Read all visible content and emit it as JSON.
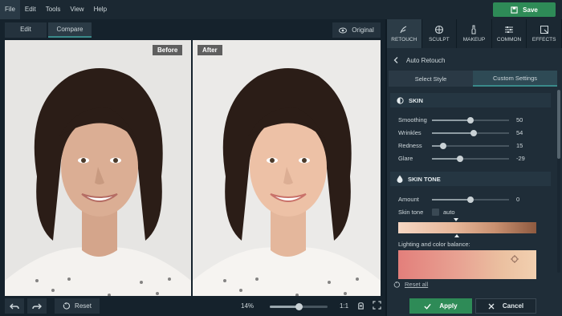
{
  "menu": {
    "items": [
      "File",
      "Edit",
      "Tools",
      "View",
      "Help"
    ],
    "save_label": "Save"
  },
  "view": {
    "edit_label": "Edit",
    "compare_label": "Compare",
    "original_label": "Original",
    "before_label": "Before",
    "after_label": "After"
  },
  "bottom": {
    "reset_label": "Reset",
    "zoom_percent": "14%",
    "zoom_level": 0.5,
    "ratio_label": "1:1"
  },
  "tools": {
    "tabs": [
      {
        "label": "RETOUCH",
        "icon": "retouch-icon"
      },
      {
        "label": "SCULPT",
        "icon": "sculpt-icon"
      },
      {
        "label": "MAKEUP",
        "icon": "makeup-icon"
      },
      {
        "label": "COMMON",
        "icon": "sliders-icon"
      },
      {
        "label": "EFFECTS",
        "icon": "effects-icon"
      }
    ]
  },
  "panel": {
    "title": "Auto Retouch",
    "segments": [
      "Select Style",
      "Custom Settings"
    ],
    "skin": {
      "title": "SKIN",
      "sliders": [
        {
          "label": "Smoothing",
          "value": "50",
          "level": 0.5
        },
        {
          "label": "Wrinkles",
          "value": "54",
          "level": 0.54
        },
        {
          "label": "Redness",
          "value": "15",
          "level": 0.15
        },
        {
          "label": "Glare",
          "value": "-29",
          "level": 0.36
        }
      ]
    },
    "skin_tone": {
      "title": "SKIN TONE",
      "amount_label": "Amount",
      "amount_value": "0",
      "amount_level": 0.5,
      "skin_tone_label": "Skin tone",
      "auto_label": "auto",
      "lighting_label": "Lighting and color balance:"
    },
    "reset_all_label": "Reset all",
    "apply_label": "Apply",
    "cancel_label": "Cancel"
  },
  "colors": {
    "accent_green": "#2e8b57",
    "teal_underline": "#3a8a8a",
    "panel_bg": "#1f2d38",
    "app_bg": "#0f1b24"
  }
}
